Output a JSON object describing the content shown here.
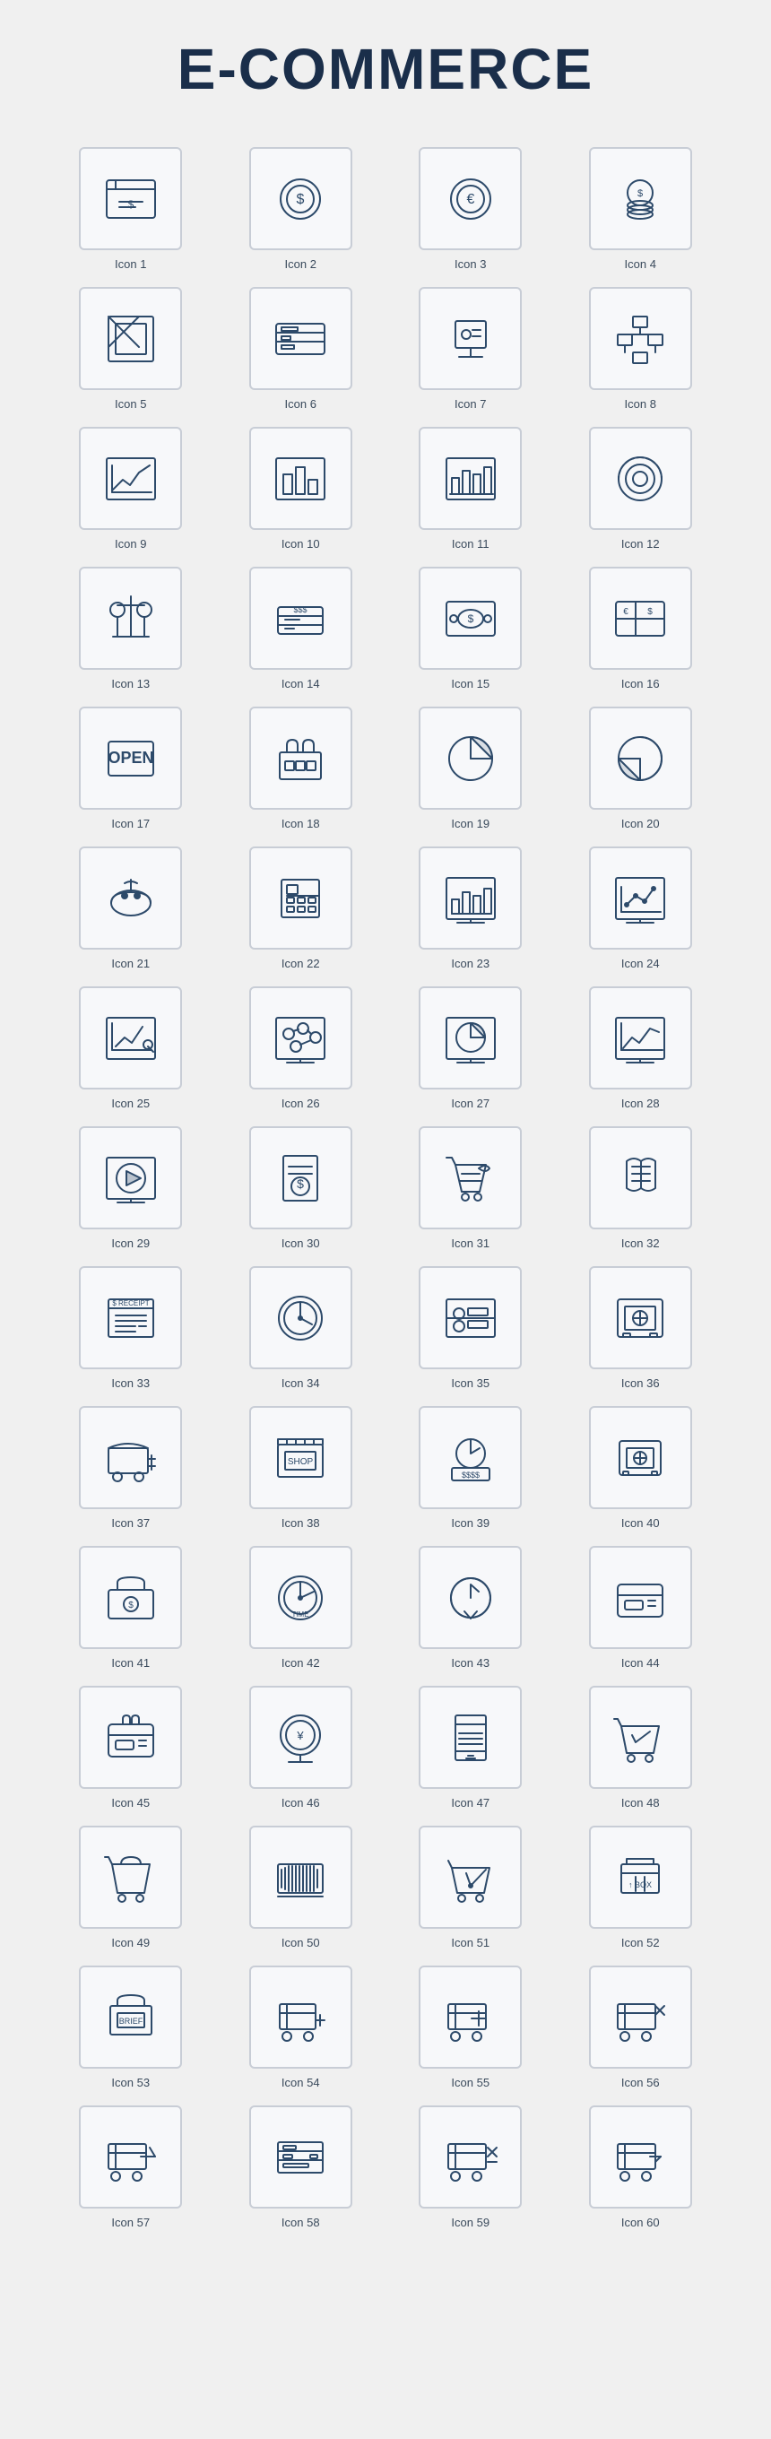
{
  "title": "E-COMMERCE",
  "icons": [
    {
      "id": 1,
      "label": "Icon 1"
    },
    {
      "id": 2,
      "label": "Icon 2"
    },
    {
      "id": 3,
      "label": "Icon 3"
    },
    {
      "id": 4,
      "label": "Icon 4"
    },
    {
      "id": 5,
      "label": "Icon 5"
    },
    {
      "id": 6,
      "label": "Icon 6"
    },
    {
      "id": 7,
      "label": "Icon 7"
    },
    {
      "id": 8,
      "label": "Icon 8"
    },
    {
      "id": 9,
      "label": "Icon 9"
    },
    {
      "id": 10,
      "label": "Icon 10"
    },
    {
      "id": 11,
      "label": "Icon 11"
    },
    {
      "id": 12,
      "label": "Icon 12"
    },
    {
      "id": 13,
      "label": "Icon 13"
    },
    {
      "id": 14,
      "label": "Icon 14"
    },
    {
      "id": 15,
      "label": "Icon 15"
    },
    {
      "id": 16,
      "label": "Icon 16"
    },
    {
      "id": 17,
      "label": "Icon 17"
    },
    {
      "id": 18,
      "label": "Icon 18"
    },
    {
      "id": 19,
      "label": "Icon 19"
    },
    {
      "id": 20,
      "label": "Icon 20"
    },
    {
      "id": 21,
      "label": "Icon 21"
    },
    {
      "id": 22,
      "label": "Icon 22"
    },
    {
      "id": 23,
      "label": "Icon 23"
    },
    {
      "id": 24,
      "label": "Icon 24"
    },
    {
      "id": 25,
      "label": "Icon 25"
    },
    {
      "id": 26,
      "label": "Icon 26"
    },
    {
      "id": 27,
      "label": "Icon 27"
    },
    {
      "id": 28,
      "label": "Icon 28"
    },
    {
      "id": 29,
      "label": "Icon 29"
    },
    {
      "id": 30,
      "label": "Icon 30"
    },
    {
      "id": 31,
      "label": "Icon 31"
    },
    {
      "id": 32,
      "label": "Icon 32"
    },
    {
      "id": 33,
      "label": "Icon 33"
    },
    {
      "id": 34,
      "label": "Icon 34"
    },
    {
      "id": 35,
      "label": "Icon 35"
    },
    {
      "id": 36,
      "label": "Icon 36"
    },
    {
      "id": 37,
      "label": "Icon 37"
    },
    {
      "id": 38,
      "label": "Icon 38"
    },
    {
      "id": 39,
      "label": "Icon 39"
    },
    {
      "id": 40,
      "label": "Icon 40"
    },
    {
      "id": 41,
      "label": "Icon 41"
    },
    {
      "id": 42,
      "label": "Icon 42"
    },
    {
      "id": 43,
      "label": "Icon 43"
    },
    {
      "id": 44,
      "label": "Icon 44"
    },
    {
      "id": 45,
      "label": "Icon 45"
    },
    {
      "id": 46,
      "label": "Icon 46"
    },
    {
      "id": 47,
      "label": "Icon 47"
    },
    {
      "id": 48,
      "label": "Icon 48"
    },
    {
      "id": 49,
      "label": "Icon 49"
    },
    {
      "id": 50,
      "label": "Icon 50"
    },
    {
      "id": 51,
      "label": "Icon 51"
    },
    {
      "id": 52,
      "label": "Icon 52"
    },
    {
      "id": 53,
      "label": "Icon 53"
    },
    {
      "id": 54,
      "label": "Icon 54"
    },
    {
      "id": 55,
      "label": "Icon 55"
    },
    {
      "id": 56,
      "label": "Icon 56"
    },
    {
      "id": 57,
      "label": "Icon 57"
    },
    {
      "id": 58,
      "label": "Icon 58"
    },
    {
      "id": 59,
      "label": "Icon 59"
    },
    {
      "id": 60,
      "label": "Icon 60"
    }
  ]
}
